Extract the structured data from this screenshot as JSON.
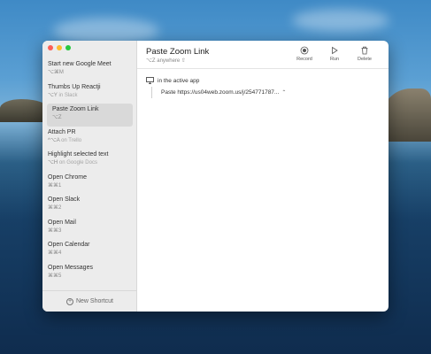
{
  "window": {
    "title": "Paste Zoom Link",
    "trigger": "⌥Z anywhere ⇧",
    "toolbar": {
      "record_label": "Record",
      "run_label": "Run",
      "delete_label": "Delete"
    },
    "condition_label": "in the active app",
    "action_text": "Paste https://us04web.zoom.us/j/254771787..."
  },
  "sidebar": {
    "items": [
      {
        "title": "Start new Google Meet",
        "shortcut": "⌥⌘M",
        "app": ""
      },
      {
        "title": "Thumbs Up Reactji",
        "shortcut": "⌥Y",
        "app": "in Slack"
      },
      {
        "title": "Paste Zoom Link",
        "shortcut": "⌥Z",
        "app": ""
      },
      {
        "title": "Attach PR",
        "shortcut": "^⌥A",
        "app": "on Trello"
      },
      {
        "title": "Highlight selected text",
        "shortcut": "⌥H",
        "app": "on Google Docs"
      },
      {
        "title": "Open Chrome",
        "shortcut": "⌘⌘1",
        "app": ""
      },
      {
        "title": "Open Slack",
        "shortcut": "⌘⌘2",
        "app": ""
      },
      {
        "title": "Open Mail",
        "shortcut": "⌘⌘3",
        "app": ""
      },
      {
        "title": "Open Calendar",
        "shortcut": "⌘⌘4",
        "app": ""
      },
      {
        "title": "Open Messages",
        "shortcut": "⌘⌘5",
        "app": ""
      }
    ],
    "selected_index": 2,
    "new_shortcut_label": "New Shortcut"
  },
  "icons": {
    "record": "record-icon",
    "run": "play-icon",
    "delete": "trash-icon",
    "monitor": "monitor-icon",
    "add": "plus-circle-icon"
  },
  "colors": {
    "close": "#fc5f57",
    "minimize": "#fdbc2e",
    "zoom": "#28c840",
    "selected_bg": "#d9d9d9"
  }
}
